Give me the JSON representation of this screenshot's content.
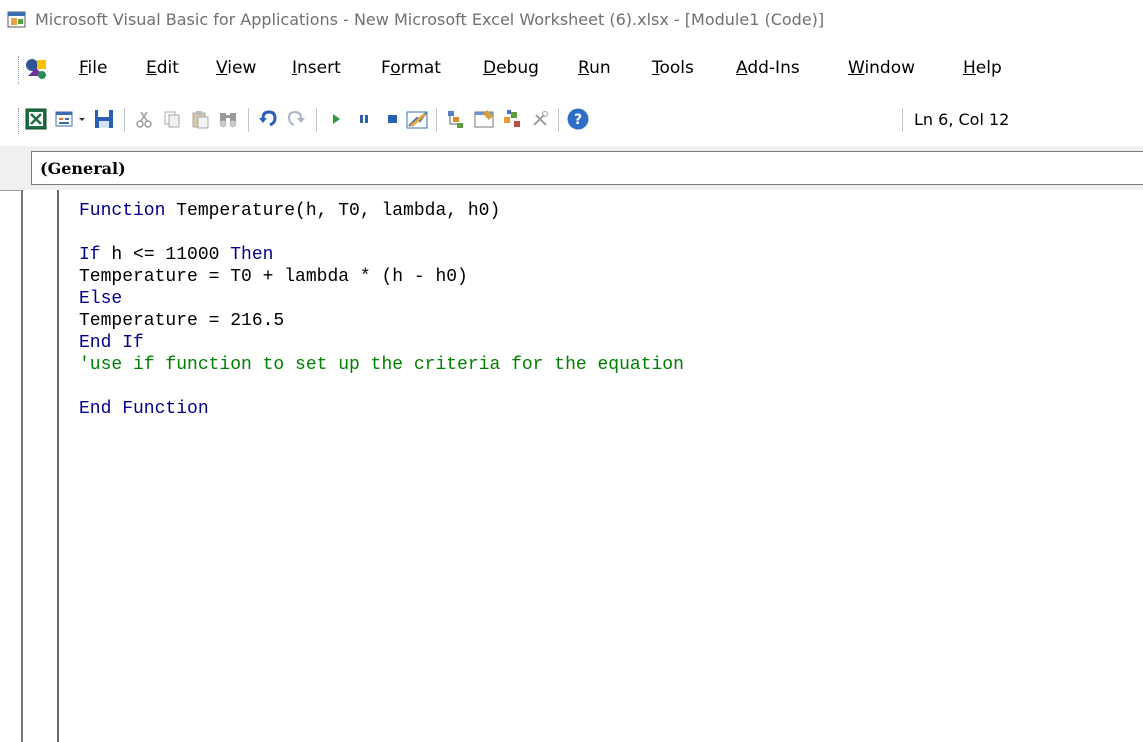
{
  "window": {
    "title": "Microsoft Visual Basic for Applications - New Microsoft Excel Worksheet (6).xlsx - [Module1 (Code)]"
  },
  "menu": {
    "items": [
      {
        "label": "File",
        "underline_index": 0
      },
      {
        "label": "Edit",
        "underline_index": 0
      },
      {
        "label": "View",
        "underline_index": 0
      },
      {
        "label": "Insert",
        "underline_index": 0
      },
      {
        "label": "Format",
        "underline_index": 1
      },
      {
        "label": "Debug",
        "underline_index": 0
      },
      {
        "label": "Run",
        "underline_index": 0
      },
      {
        "label": "Tools",
        "underline_index": 0
      },
      {
        "label": "Add-Ins",
        "underline_index": 0
      },
      {
        "label": "Window",
        "underline_index": 0
      },
      {
        "label": "Help",
        "underline_index": 0
      }
    ]
  },
  "toolbar": {
    "buttons": [
      "view-excel-icon",
      "insert-userform-icon",
      "dropdown-arrow-icon",
      "save-icon",
      "cut-icon",
      "copy-icon",
      "paste-icon",
      "find-icon",
      "undo-icon",
      "redo-icon",
      "run-icon",
      "break-icon",
      "reset-icon",
      "design-mode-icon",
      "project-explorer-icon",
      "properties-window-icon",
      "object-browser-icon",
      "toolbox-icon",
      "help-icon"
    ],
    "cursor_position": "Ln 6, Col 12"
  },
  "procedure_bar": {
    "object": "(General)"
  },
  "code": {
    "lines": [
      {
        "segments": [
          {
            "t": "kw",
            "text": "Function"
          },
          {
            "t": "tx",
            "text": " Temperature(h, T0, lambda, h0)"
          }
        ]
      },
      {
        "segments": []
      },
      {
        "segments": [
          {
            "t": "kw",
            "text": "If"
          },
          {
            "t": "tx",
            "text": " h <= 11000 "
          },
          {
            "t": "kw",
            "text": "Then"
          }
        ]
      },
      {
        "segments": [
          {
            "t": "tx",
            "text": "Temperature = T0 + lambda * (h - h0)"
          }
        ]
      },
      {
        "segments": [
          {
            "t": "kw",
            "text": "Else"
          }
        ]
      },
      {
        "segments": [
          {
            "t": "tx",
            "text": "Temperature = 216.5"
          }
        ]
      },
      {
        "segments": [
          {
            "t": "kw",
            "text": "End If"
          }
        ]
      },
      {
        "segments": [
          {
            "t": "cm",
            "text": "'use if function to set up the criteria for the equation"
          }
        ]
      },
      {
        "segments": []
      },
      {
        "segments": [
          {
            "t": "kw",
            "text": "End Function"
          }
        ]
      }
    ]
  },
  "colors": {
    "keyword": "#00008b",
    "comment": "#008000",
    "text": "#000000"
  }
}
